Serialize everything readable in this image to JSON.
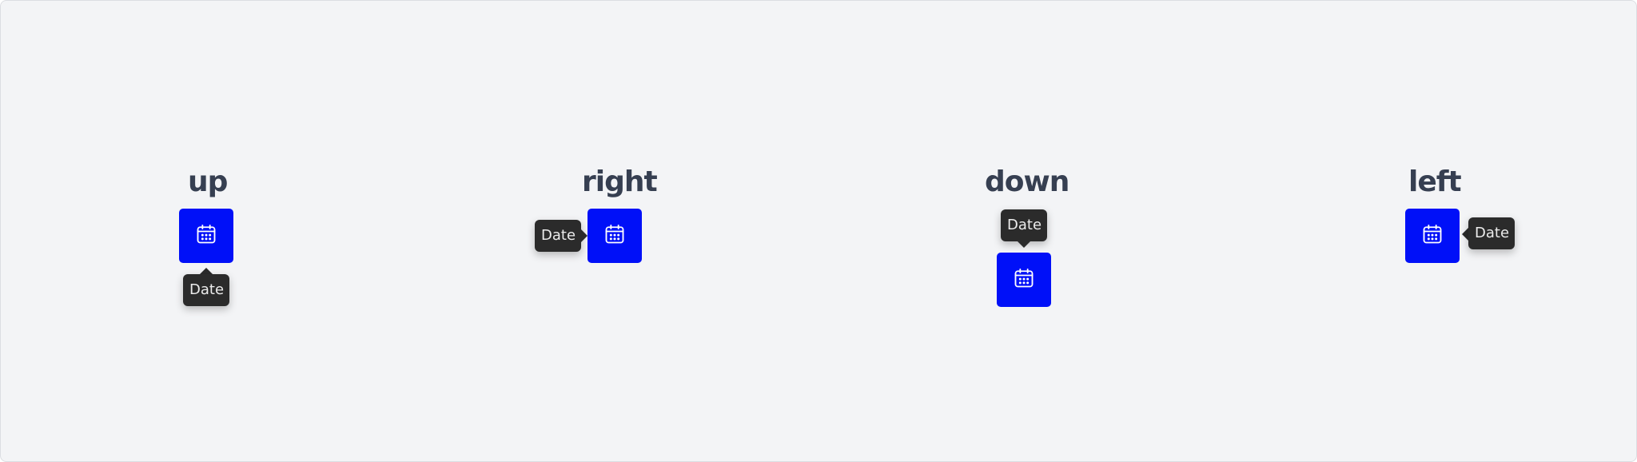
{
  "demos": [
    {
      "heading": "up",
      "tooltip": "Date",
      "icon": "calendar-icon"
    },
    {
      "heading": "right",
      "tooltip": "Date",
      "icon": "calendar-icon"
    },
    {
      "heading": "down",
      "tooltip": "Date",
      "icon": "calendar-icon"
    },
    {
      "heading": "left",
      "tooltip": "Date",
      "icon": "calendar-icon"
    }
  ],
  "colors": {
    "background": "#f3f4f6",
    "button": "#0010f8",
    "tooltip": "#2b2b2b",
    "heading": "#363f51"
  }
}
